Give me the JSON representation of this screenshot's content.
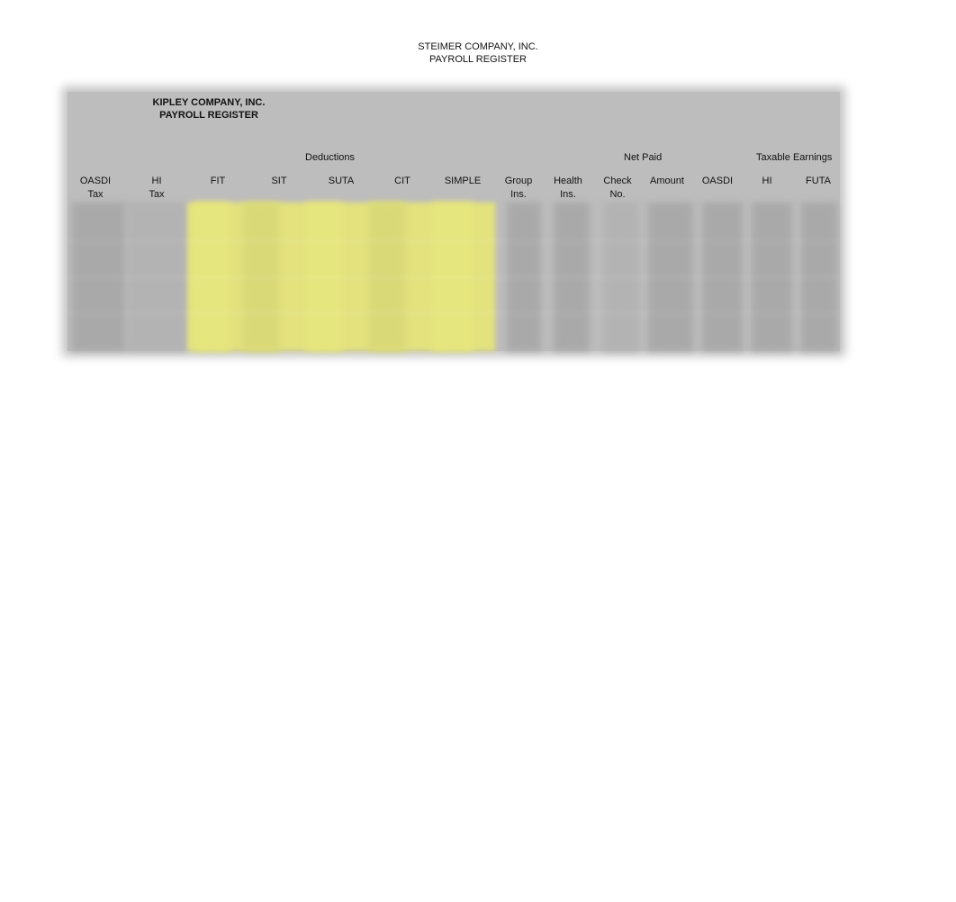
{
  "header": {
    "company": "STEIMER COMPANY, INC.",
    "report": "PAYROLL REGISTER"
  },
  "sheet": {
    "company": "KIPLEY COMPANY, INC.",
    "report": "PAYROLL REGISTER",
    "groups": {
      "deductions": "Deductions",
      "net_paid": "Net Paid",
      "taxable_earnings": "Taxable Earnings"
    },
    "columns": [
      {
        "line1": "OASDI",
        "line2": "Tax"
      },
      {
        "line1": "HI",
        "line2": "Tax"
      },
      {
        "line1": "FIT",
        "line2": ""
      },
      {
        "line1": "SIT",
        "line2": ""
      },
      {
        "line1": "SUTA",
        "line2": ""
      },
      {
        "line1": "CIT",
        "line2": ""
      },
      {
        "line1": "SIMPLE",
        "line2": ""
      },
      {
        "line1": "Group",
        "line2": "Ins."
      },
      {
        "line1": "Health",
        "line2": "Ins."
      },
      {
        "line1": "Check",
        "line2": "No."
      },
      {
        "line1": "Amount",
        "line2": ""
      },
      {
        "line1": "OASDI",
        "line2": ""
      },
      {
        "line1": "HI",
        "line2": ""
      },
      {
        "line1": "FUTA",
        "line2": ""
      }
    ],
    "colors": {
      "sheet_bg": "#bdbdbd",
      "highlight_yellow": "#e6e67e"
    }
  }
}
